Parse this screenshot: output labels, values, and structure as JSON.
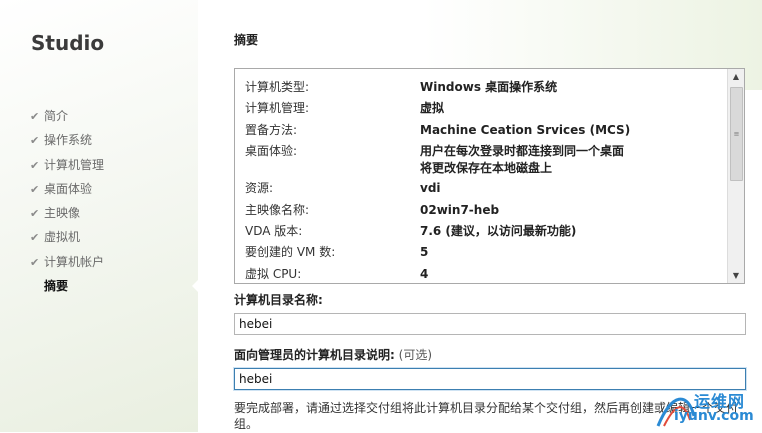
{
  "sidebar": {
    "brand": "Studio",
    "steps": [
      {
        "label": "简介",
        "done": true
      },
      {
        "label": "操作系统",
        "done": true
      },
      {
        "label": "计算机管理",
        "done": true
      },
      {
        "label": "桌面体验",
        "done": true
      },
      {
        "label": "主映像",
        "done": true
      },
      {
        "label": "虚拟机",
        "done": true
      },
      {
        "label": "计算机帐户",
        "done": true
      },
      {
        "label": "摘要",
        "done": false,
        "current": true
      }
    ],
    "check_glyph": "✔"
  },
  "main": {
    "title": "摘要",
    "summary": [
      {
        "key": "计算机类型:",
        "value": "Windows 桌面操作系统"
      },
      {
        "key": "计算机管理:",
        "value": "虚拟"
      },
      {
        "key": "置备方法:",
        "value": "Machine Ceation Srvices (MCS)"
      },
      {
        "key": "桌面体验:",
        "value": "用户在每次登录时都连接到同一个桌面",
        "value2": "将更改保存在本地磁盘上"
      },
      {
        "key": "资源:",
        "value": "vdi"
      },
      {
        "key": "主映像名称:",
        "value": "02win7-heb"
      },
      {
        "key": "VDA 版本:",
        "value": "7.6 (建议，以访问最新功能)"
      },
      {
        "key": "要创建的 VM 数:",
        "value": "5"
      },
      {
        "key": "虚拟 CPU:",
        "value": "4"
      }
    ],
    "scroll": {
      "up": "▲",
      "down": "▼",
      "thumb": "≡"
    },
    "catalog_name_label": "计算机目录名称:",
    "catalog_name_value": "hebei",
    "description_label": "面向管理员的计算机目录说明:",
    "description_optional": "(可选)",
    "description_value": "hebei",
    "note": "要完成部署，请通过选择交付组将此计算机目录分配给某个交付组，然后再创建或编辑一个交付组。"
  },
  "watermark": {
    "line1": "运维网",
    "line2": "iyunv.com"
  }
}
